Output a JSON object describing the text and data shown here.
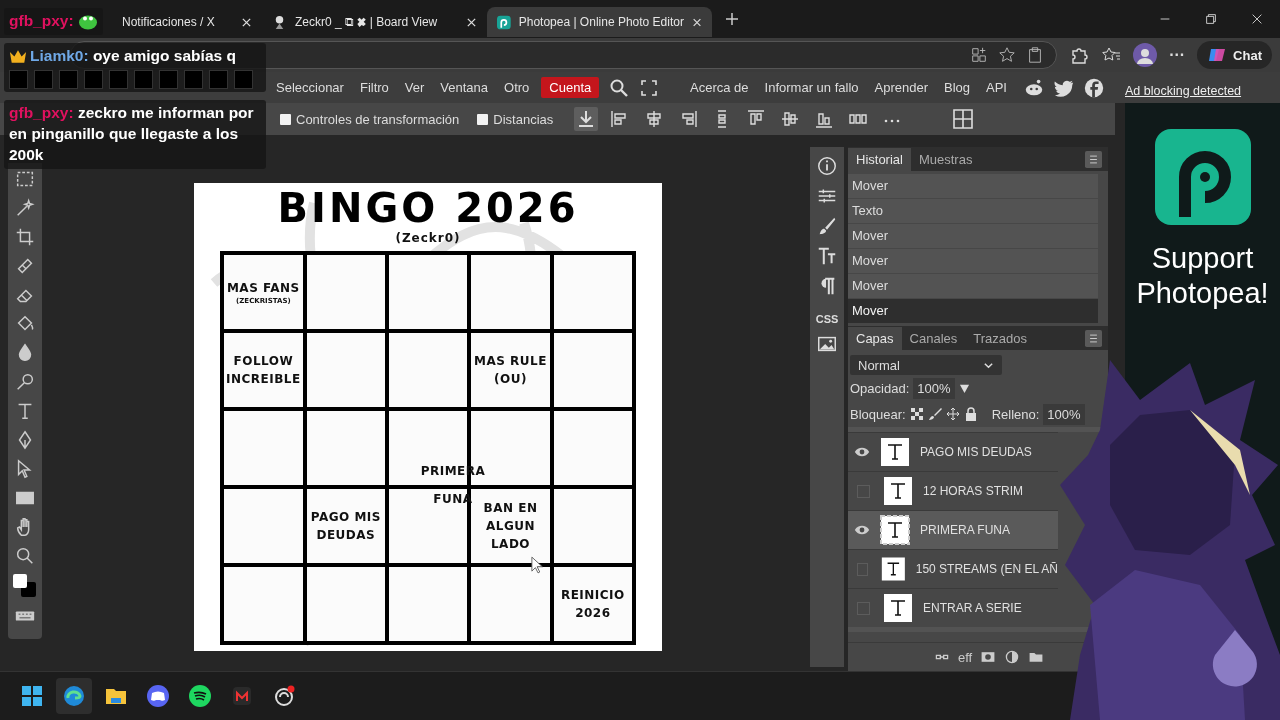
{
  "browser": {
    "tabs": [
      {
        "title": "Notificaciones / X",
        "selected": false
      },
      {
        "title": "Zeckr0 _ ⧉ ✖ | Board View",
        "selected": false
      },
      {
        "title": "Photopea | Online Photo Editor",
        "selected": true
      }
    ],
    "more": "···",
    "chat_button": "Chat"
  },
  "chat_overlay": [
    {
      "kind": "emote",
      "user": "gfb_pxy:",
      "color": "#e0115f"
    },
    {
      "kind": "text_emotes",
      "user": "Liamk0:",
      "color": "#6fa8e6",
      "badge": true,
      "message": "oye amigo sabías q"
    },
    {
      "kind": "text",
      "user": "gfb_pxy:",
      "color": "#e0115f",
      "message": "zeckro me informan por en pinganillo que llegaste a los 200k"
    }
  ],
  "menu": [
    {
      "label": "Seleccionar",
      "kind": "menu"
    },
    {
      "label": "Filtro",
      "kind": "menu"
    },
    {
      "label": "Ver",
      "kind": "menu"
    },
    {
      "label": "Ventana",
      "kind": "menu"
    },
    {
      "label": "Otro",
      "kind": "menu"
    },
    {
      "label": "Cuenta",
      "kind": "account"
    }
  ],
  "links": [
    "Acerca de",
    "Informar un fallo",
    "Aprender",
    "Blog",
    "API"
  ],
  "options": [
    {
      "label": "Controles de transformación",
      "checked": false
    },
    {
      "label": "Distancias",
      "checked": false
    }
  ],
  "document": {
    "title": "BINGO 2026",
    "subtitle": "(Zeckr0)",
    "rows": [
      [
        {
          "text": "MAS FANS",
          "note": "(ZECKRISTAS)"
        },
        {},
        {},
        {},
        {}
      ],
      [
        {
          "text": "FOLLOW INCREIBLE"
        },
        {},
        {},
        {
          "text": "MAS RULE (OU)"
        },
        {}
      ],
      [
        {},
        {},
        {},
        {},
        {}
      ],
      [
        {},
        {
          "text": "PAGO MIS DEUDAS"
        },
        {},
        {
          "text": "BAN EN ALGUN LADO"
        },
        {}
      ],
      [
        {},
        {},
        {},
        {},
        {
          "text": "REINICIO 2026"
        }
      ]
    ],
    "floating_text": "PRIMERA FUNA"
  },
  "side_icons": {
    "css_label": "CSS"
  },
  "history": {
    "tabs": [
      {
        "label": "Historial",
        "selected": true
      },
      {
        "label": "Muestras",
        "selected": false
      }
    ],
    "items": [
      {
        "label": "Mover",
        "selected": false
      },
      {
        "label": "Texto",
        "selected": false
      },
      {
        "label": "Mover",
        "selected": false
      },
      {
        "label": "Mover",
        "selected": false
      },
      {
        "label": "Mover",
        "selected": false
      },
      {
        "label": "Mover",
        "selected": true
      }
    ]
  },
  "layers": {
    "tabs": [
      {
        "label": "Capas",
        "selected": true
      },
      {
        "label": "Canales",
        "selected": false
      },
      {
        "label": "Trazados",
        "selected": false
      }
    ],
    "blend_mode": "Normal",
    "opacity_label": "Opacidad:",
    "opacity": "100%",
    "lock_label": "Bloquear:",
    "fill_label": "Relleno:",
    "fill": "100%",
    "items": [
      {
        "name": "PAGO MIS DEUDAS",
        "visible": true,
        "selected": false
      },
      {
        "name": "12 HORAS STRIM",
        "visible": false,
        "selected": false
      },
      {
        "name": "PRIMERA FUNA",
        "visible": true,
        "selected": true
      },
      {
        "name": "150 STREAMS (EN EL AÑ",
        "visible": false,
        "selected": false
      },
      {
        "name": "ENTRAR A SERIE",
        "visible": false,
        "selected": false
      }
    ],
    "footer": "eff"
  },
  "ad": {
    "link": "Ad blocking detected",
    "headline": "Support Photopea!"
  }
}
